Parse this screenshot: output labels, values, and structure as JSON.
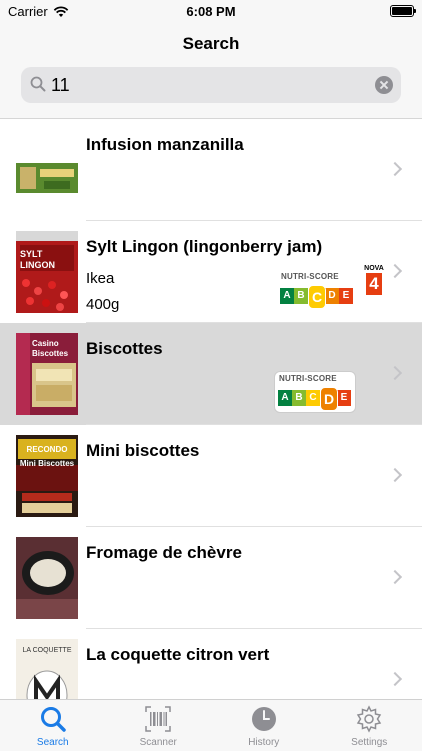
{
  "status_bar": {
    "carrier": "Carrier",
    "time": "6:08 PM"
  },
  "nav": {
    "title": "Search"
  },
  "search": {
    "value": "11",
    "placeholder": ""
  },
  "colors": {
    "accent": "#1a7be6",
    "nutri_a": "#038141",
    "nutri_b": "#85bb2f",
    "nutri_c": "#fecb02",
    "nutri_d": "#ee8100",
    "nutri_e": "#e63e11"
  },
  "results": [
    {
      "title": "Infusion manzanilla",
      "brand": "",
      "quantity": ""
    },
    {
      "title": "Sylt Lingon (lingonberry jam)",
      "brand": "Ikea",
      "quantity": "400g",
      "nutriscore": "C",
      "nova": "4"
    },
    {
      "title": "Biscottes",
      "brand": "",
      "quantity": "",
      "nutriscore": "D"
    },
    {
      "title": "Mini biscottes",
      "brand": "",
      "quantity": ""
    },
    {
      "title": "Fromage de chèvre",
      "brand": "",
      "quantity": ""
    },
    {
      "title": "La coquette citron vert",
      "brand": "",
      "quantity": ""
    }
  ],
  "nutri_labels": {
    "title": "NUTRI-SCORE",
    "letters": [
      "A",
      "B",
      "C",
      "D",
      "E"
    ],
    "nova_title": "NOVA"
  },
  "thumbs": [
    {
      "text": ""
    },
    {
      "text": "SYLT LINGON"
    },
    {
      "text": "Casino Biscottes"
    },
    {
      "text": "RECONDO Mini Biscottes"
    },
    {
      "text": ""
    },
    {
      "text": "LA COQUETTE"
    }
  ],
  "tabbar": {
    "tabs": [
      {
        "label": "Search",
        "icon": "search-icon",
        "active": true
      },
      {
        "label": "Scanner",
        "icon": "barcode-icon",
        "active": false
      },
      {
        "label": "History",
        "icon": "clock-icon",
        "active": false
      },
      {
        "label": "Settings",
        "icon": "gear-icon",
        "active": false
      }
    ]
  }
}
